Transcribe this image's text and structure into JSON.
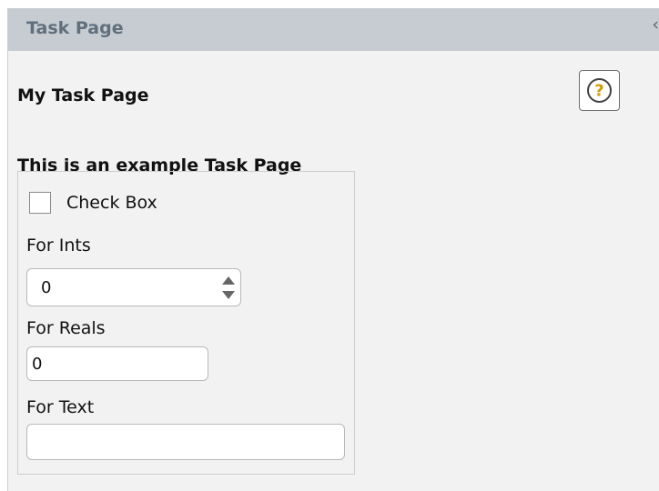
{
  "panel": {
    "title": "Task Page",
    "collapse_icon": "chevron-left-icon",
    "heading": "My Task Page",
    "help_icon": "question-circle-icon",
    "help_symbol": "?",
    "help_color": "#d19a00"
  },
  "group": {
    "label": "This is an example Task Page",
    "checkbox": {
      "label": "Check Box",
      "checked": false
    },
    "ints": {
      "label": "For Ints",
      "value": "0"
    },
    "reals": {
      "label": "For Reals",
      "value": "0"
    },
    "text": {
      "label": "For Text",
      "value": ""
    }
  },
  "colors": {
    "title_bar": "#c6ccd2",
    "title_text": "#616f7d",
    "panel_background": "#f2f2f2"
  }
}
